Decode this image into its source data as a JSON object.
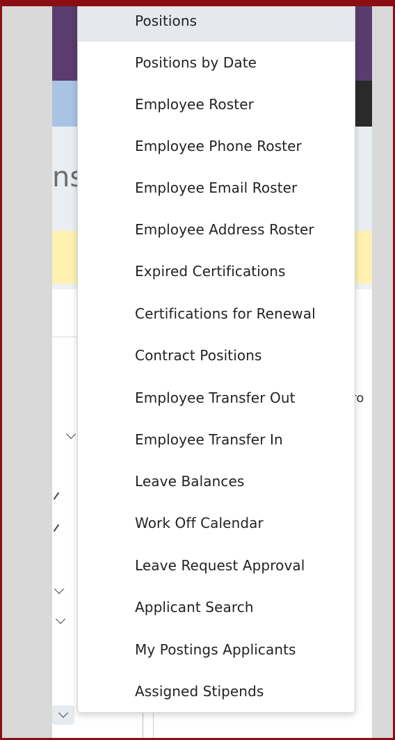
{
  "background": {
    "partial_heading": "ns",
    "partial_text": "fro"
  },
  "menu": {
    "items": [
      {
        "label": "Positions",
        "active": true
      },
      {
        "label": "Positions by Date"
      },
      {
        "label": "Employee Roster"
      },
      {
        "label": "Employee Phone Roster"
      },
      {
        "label": "Employee Email Roster"
      },
      {
        "label": "Employee Address Roster"
      },
      {
        "label": "Expired Certifications"
      },
      {
        "label": "Certifications for Renewal"
      },
      {
        "label": "Contract Positions"
      },
      {
        "label": "Employee Transfer Out"
      },
      {
        "label": "Employee Transfer In"
      },
      {
        "label": "Leave Balances"
      },
      {
        "label": "Work Off Calendar"
      },
      {
        "label": "Leave Request Approval"
      },
      {
        "label": "Applicant Search"
      },
      {
        "label": "My Postings Applicants"
      },
      {
        "label": "Assigned Stipends"
      }
    ]
  },
  "colors": {
    "frame": "#8b0e12",
    "header": "#5a3c6e",
    "nav": "#a9c3e2",
    "alert": "#fff1b0",
    "active_item": "#e5e8ec"
  }
}
